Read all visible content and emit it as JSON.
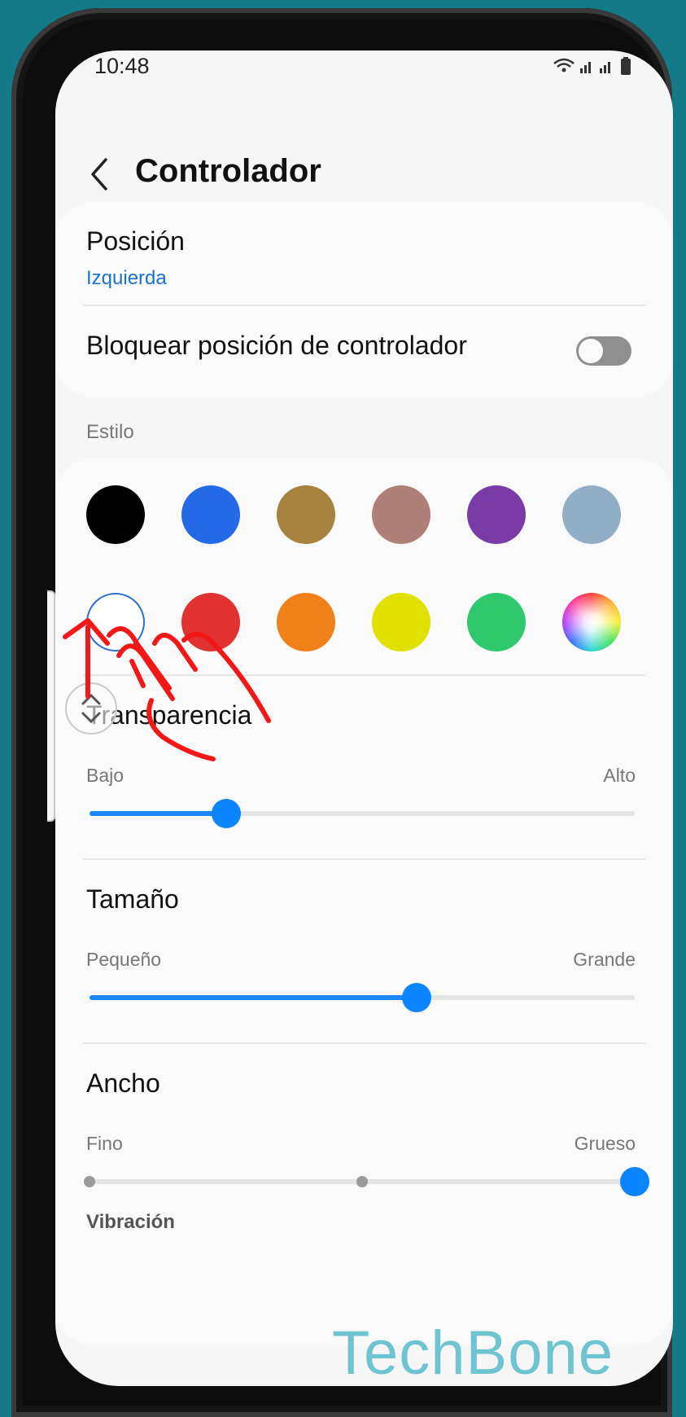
{
  "status": {
    "time": "10:48"
  },
  "header": {
    "title": "Controlador"
  },
  "position": {
    "label": "Posición",
    "value": "Izquierda"
  },
  "lock": {
    "label": "Bloquear posición de controlador",
    "enabled": false
  },
  "style": {
    "label": "Estilo",
    "colors": [
      {
        "name": "black",
        "hex": "#000000"
      },
      {
        "name": "blue",
        "hex": "#2369e8"
      },
      {
        "name": "ochre",
        "hex": "#a8833f"
      },
      {
        "name": "dusty-rose",
        "hex": "#b07f78"
      },
      {
        "name": "purple",
        "hex": "#7a3aa8"
      },
      {
        "name": "gray-blue",
        "hex": "#90aec6"
      },
      {
        "name": "white",
        "hex": "#ffffff",
        "selected": true
      },
      {
        "name": "red",
        "hex": "#e23131"
      },
      {
        "name": "orange",
        "hex": "#f08018"
      },
      {
        "name": "yellow",
        "hex": "#e2e000"
      },
      {
        "name": "green",
        "hex": "#2fc86c"
      },
      {
        "name": "custom-wheel",
        "hex": "conic"
      }
    ]
  },
  "transparency": {
    "label": "Transparencia",
    "min_label": "Bajo",
    "max_label": "Alto",
    "value": 0.25
  },
  "size": {
    "label": "Tamaño",
    "min_label": "Pequeño",
    "max_label": "Grande",
    "value": 0.6
  },
  "width": {
    "label": "Ancho",
    "min_label": "Fino",
    "max_label": "Grueso",
    "value": 1.0,
    "steps": 3
  },
  "vibration": {
    "label": "Vibración"
  },
  "watermark": "TechBone",
  "colors": {
    "accent": "#1a86f3",
    "link": "#1a73c8",
    "background": "#157a88"
  }
}
